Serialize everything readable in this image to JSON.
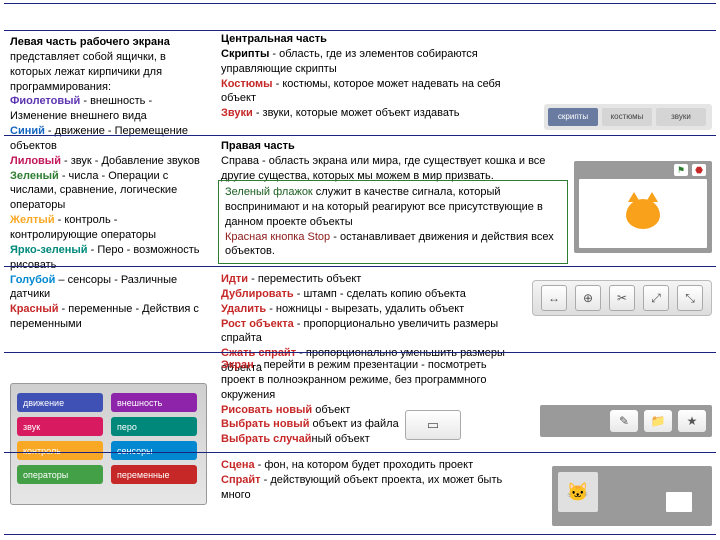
{
  "left": {
    "intro_bold": "Левая часть рабочего экрана",
    "intro_rest": " представляет собой ящички, в которых лежат кирпичики для программирования:",
    "items": [
      {
        "name": "Фиолетовый",
        "cls": "c-violet",
        "desc": " - внешность - Изменение внешнего вида"
      },
      {
        "name": "Синий",
        "cls": "c-blue",
        "desc": " - движение - Перемещение объектов"
      },
      {
        "name": "Лиловый",
        "cls": "c-lilac",
        "desc": " - звук - Добавление звуков"
      },
      {
        "name": "Зеленый",
        "cls": "c-green",
        "desc": " - числа - Операции с числами, сравнение, логические операторы"
      },
      {
        "name": "Желтый",
        "cls": "c-yellow",
        "desc": " - контроль - контролирующие операторы"
      },
      {
        "name": "Ярко-зеленый",
        "cls": "c-bgreen",
        "desc": " - Перо - возможность рисовать"
      },
      {
        "name": "Голубой",
        "cls": "c-lblue",
        "desc": " – сенсоры - Различные датчики"
      },
      {
        "name": "Красный",
        "cls": "c-red",
        "desc": " - переменные - Действия с переменными"
      }
    ]
  },
  "center": {
    "title": "Центральная часть",
    "scripts_name": "Скрипты",
    "scripts_desc": " - область, где из элементов собираются управляющие скрипты",
    "costumes_name": "Костюмы",
    "costumes_desc": " - костюмы, которое может надевать на себя объект",
    "sounds_name": "Звуки",
    "sounds_desc": " - звуки, которые может объект издавать"
  },
  "tabs": {
    "t1": "скрипты",
    "t2": "костюмы",
    "t3": "звуки"
  },
  "right": {
    "title": "Правая часть",
    "desc": "Справа - область экрана или мира, где существует кошка и все другие существа, которых мы можем в мир призвать."
  },
  "flags": {
    "green_name": "Зеленый флажок",
    "green_desc": " служит в качестве сигнала, который воспринимают и на который реагируют все присутствующие в данном проекте объекты",
    "stop_name": "Красная кнопка Stop",
    "stop_desc": " - останавливает движения и действия всех объектов."
  },
  "tools": {
    "move_name": "Идти",
    "move_desc": " - переместить объект",
    "dup_name": "Дублировать",
    "dup_desc": " - штамп - сделать копию объекта",
    "del_name": "Удалить",
    "del_desc": " - ножницы - вырезать, удалить объект",
    "grow_name": "Рост объекта",
    "grow_desc": " - пропорционально увеличить размеры спрайта",
    "shrink_name": "Сжать спрайт",
    "shrink_desc": " - пропорционально уменьшить размеры объекта"
  },
  "present": {
    "screen_name": "Экран",
    "screen_desc": " - перейти в режим презентации - посмотреть проект в полноэкранном режиме, без программного окружения",
    "paint_name": "Рисовать новый",
    "paint_desc": " объект",
    "choose_name": "Выбрать новый",
    "choose_desc": " объект из файла",
    "random_name": "Выбрать случай",
    "random_desc": "ный объект"
  },
  "scene": {
    "scene_name": "Сцена",
    "scene_desc": " - фон, на котором будет проходить проект",
    "sprite_name": "Спрайт",
    "sprite_desc": " - действующий объект проекта, их может быть много"
  },
  "categories_labels": {
    "l1": "движение",
    "l2": "внешность",
    "l3": "звук",
    "l4": "перо",
    "l5": "контроль",
    "l6": "сенсоры",
    "l7": "операторы",
    "l8": "переменные"
  }
}
